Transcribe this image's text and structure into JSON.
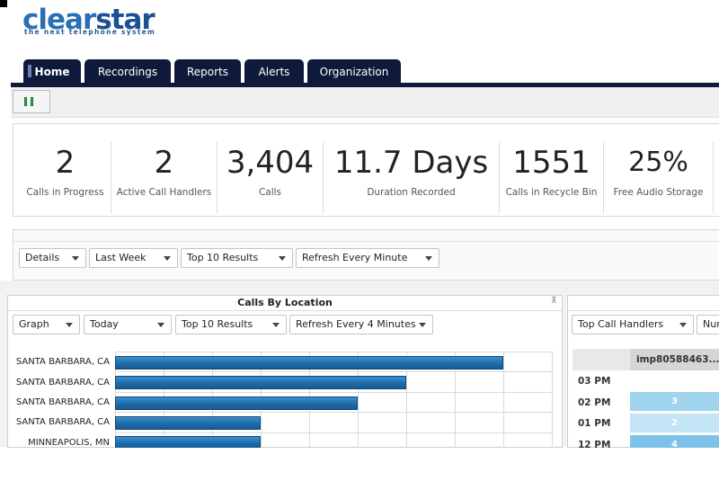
{
  "app": {
    "logo_part1": "clear",
    "logo_part2": "star",
    "tagline": "the next telephone system"
  },
  "tabs": [
    {
      "label": "Home",
      "active": true
    },
    {
      "label": "Recordings"
    },
    {
      "label": "Reports"
    },
    {
      "label": "Alerts"
    },
    {
      "label": "Organization"
    }
  ],
  "stats": [
    {
      "value": "2",
      "label": "Calls in Progress"
    },
    {
      "value": "2",
      "label": "Active Call Handlers"
    },
    {
      "value": "3,404",
      "label": "Calls"
    },
    {
      "value": "11.7 Days",
      "label": "Duration Recorded"
    },
    {
      "value": "1551",
      "label": "Calls in Recycle Bin"
    },
    {
      "value": "25%",
      "label": "Free Audio Storage"
    }
  ],
  "filters": {
    "view": "Details",
    "period": "Last Week",
    "results": "Top 10 Results",
    "refresh": "Refresh Every Minute"
  },
  "location_panel": {
    "title": "Calls By Location",
    "collapse_glyph": "⊼",
    "filters": {
      "view": "Graph",
      "period": "Today",
      "results": "Top 10 Results",
      "refresh": "Refresh Every 4 Minutes"
    }
  },
  "chart_data": {
    "type": "bar",
    "orientation": "horizontal",
    "title": "Calls By Location",
    "categories": [
      "SANTA BARBARA, CA",
      "SANTA BARBARA, CA",
      "SANTA BARBARA, CA",
      "SANTA BARBARA, CA",
      "MINNEAPOLIS, MN"
    ],
    "values": [
      8,
      6,
      5,
      3,
      3
    ],
    "xlim": [
      0,
      9
    ],
    "grid": true
  },
  "handlers_panel": {
    "filter1": "Top Call Handlers",
    "filter2": "Num",
    "column_header": "imp80588463...",
    "rows": [
      {
        "hour": "03 PM",
        "value": "",
        "color": ""
      },
      {
        "hour": "02 PM",
        "value": "3",
        "color": "#9fd3ee"
      },
      {
        "hour": "01 PM",
        "value": "2",
        "color": "#c4e5f5"
      },
      {
        "hour": "12 PM",
        "value": "4",
        "color": "#7cc2e8"
      }
    ]
  }
}
